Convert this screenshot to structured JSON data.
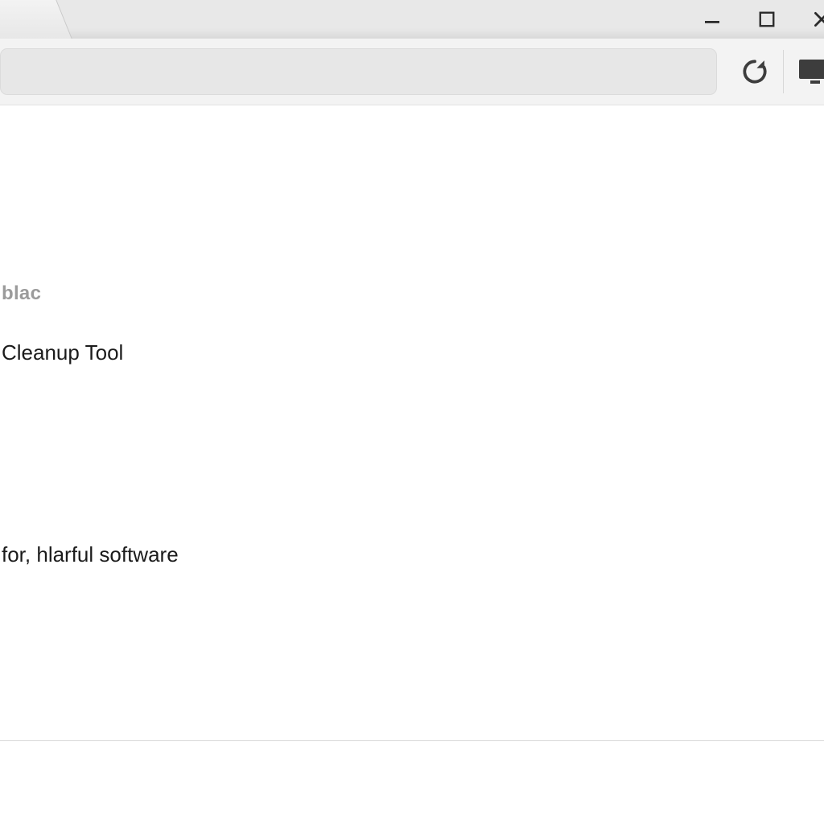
{
  "omnibox": {
    "value": "",
    "placeholder": ""
  },
  "content": {
    "breadcrumb": "blac",
    "title": "Cleanup Tool",
    "body_line": "for, hlarful software"
  },
  "icons": {
    "reload": "reload-icon",
    "cast": "cast-icon",
    "minimize": "minimize-icon",
    "maximize": "maximize-icon",
    "close": "close-icon"
  }
}
